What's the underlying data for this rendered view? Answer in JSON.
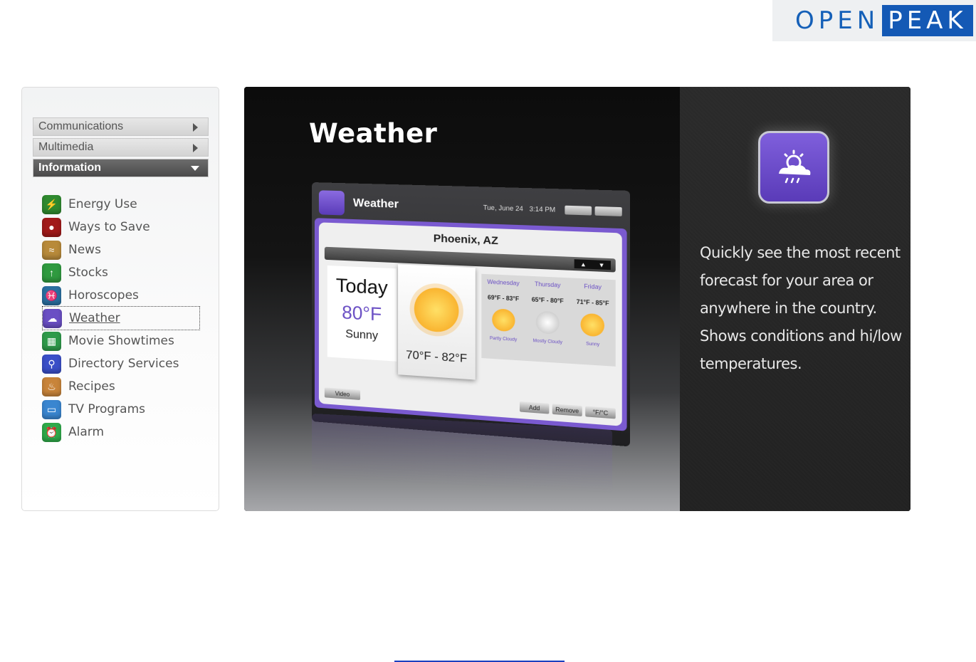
{
  "logo": {
    "open": "OPEN",
    "peak": "PEAK"
  },
  "sidebar": {
    "categories": [
      {
        "label": "Communications"
      },
      {
        "label": "Multimedia"
      },
      {
        "label": "Information"
      }
    ],
    "items": [
      {
        "label": "Energy Use",
        "icon": "energy-icon",
        "color": "#2f8a2f"
      },
      {
        "label": "Ways to Save",
        "icon": "ways-to-save-icon",
        "color": "#a11a1a"
      },
      {
        "label": "News",
        "icon": "rss-icon",
        "color": "#b88a3a"
      },
      {
        "label": "Stocks",
        "icon": "stocks-icon",
        "color": "#2f9a3f"
      },
      {
        "label": "Horoscopes",
        "icon": "pisces-icon",
        "color": "#2a6fa0"
      },
      {
        "label": "Weather",
        "icon": "weather-icon",
        "color": "#6a4fc4"
      },
      {
        "label": "Movie Showtimes",
        "icon": "film-icon",
        "color": "#2e9a4a"
      },
      {
        "label": "Directory Services",
        "icon": "directory-icon",
        "color": "#3a4fc8"
      },
      {
        "label": "Recipes",
        "icon": "recipes-icon",
        "color": "#c8843a"
      },
      {
        "label": "TV Programs",
        "icon": "tv-icon",
        "color": "#3a86d0"
      },
      {
        "label": "Alarm",
        "icon": "alarm-icon",
        "color": "#2faa4a"
      }
    ]
  },
  "main": {
    "title": "Weather",
    "description": "Quickly see the most recent forecast for your area or anywhere in the country. Shows conditions and hi/low temperatures."
  },
  "device": {
    "app_title": "Weather",
    "date": "Tue, June 24",
    "time": "3:14 PM",
    "city": "Phoenix, AZ",
    "today_label": "Today",
    "today_temp": "80°F",
    "today_condition": "Sunny",
    "today_range": "70°F - 82°F",
    "days": [
      {
        "name": "Wednesday",
        "range": "69°F - 83°F",
        "condition": "Partly Cloudy",
        "icon": "partly-cloudy-icon"
      },
      {
        "name": "Thursday",
        "range": "65°F - 80°F",
        "condition": "Mostly Cloudy",
        "icon": "cloudy-icon"
      },
      {
        "name": "Friday",
        "range": "71°F - 85°F",
        "condition": "Sunny",
        "icon": "sun-icon"
      }
    ],
    "buttons": {
      "video": "Video",
      "add": "Add",
      "remove": "Remove",
      "units": "°F/°C"
    }
  },
  "colors": {
    "accent": "#6a4fc4",
    "logo_blue": "#1459b5",
    "link": "#1a3fbf"
  }
}
